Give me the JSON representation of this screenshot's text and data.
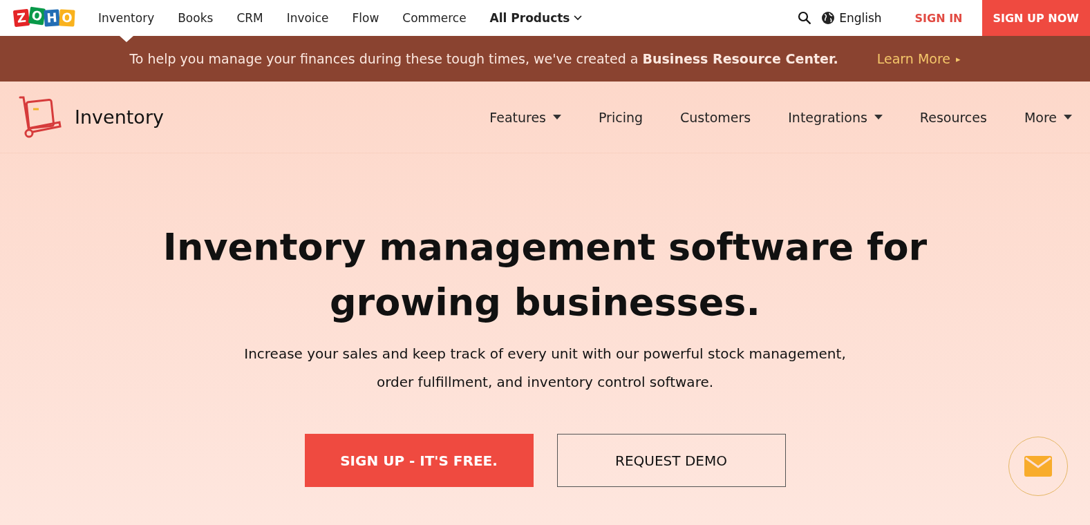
{
  "logo": [
    {
      "letter": "Z",
      "color": "#e42527"
    },
    {
      "letter": "O",
      "color": "#089949"
    },
    {
      "letter": "H",
      "color": "#226db4"
    },
    {
      "letter": "O",
      "color": "#f9b21d"
    }
  ],
  "products": [
    {
      "label": "Inventory",
      "selected": true
    },
    {
      "label": "Books",
      "selected": false
    },
    {
      "label": "CRM",
      "selected": false
    },
    {
      "label": "Invoice",
      "selected": false
    },
    {
      "label": "Flow",
      "selected": false
    },
    {
      "label": "Commerce",
      "selected": false
    }
  ],
  "all_products": "All Products",
  "language": "English",
  "sign_in": "SIGN IN",
  "sign_up_now": "SIGN UP NOW",
  "banner": {
    "text": "To help you manage your finances during these tough times, we've created a **Business Resource Center.**",
    "link": "Learn More",
    "link_arrow": "▸"
  },
  "product_name": "Inventory",
  "menu": [
    {
      "label": "Features",
      "has_menu": true
    },
    {
      "label": "Pricing",
      "has_menu": false
    },
    {
      "label": "Customers",
      "has_menu": false
    },
    {
      "label": "Integrations",
      "has_menu": true
    },
    {
      "label": "Resources",
      "has_menu": false
    },
    {
      "label": "More",
      "has_menu": true
    }
  ],
  "hero": {
    "title": "Inventory management software for growing businesses.",
    "subtitle": "Increase your sales and keep track of every unit with our powerful stock management, order fulfillment, and inventory control software.",
    "primary_button": "SIGN UP - IT'S FREE.",
    "secondary_button": "REQUEST DEMO"
  }
}
